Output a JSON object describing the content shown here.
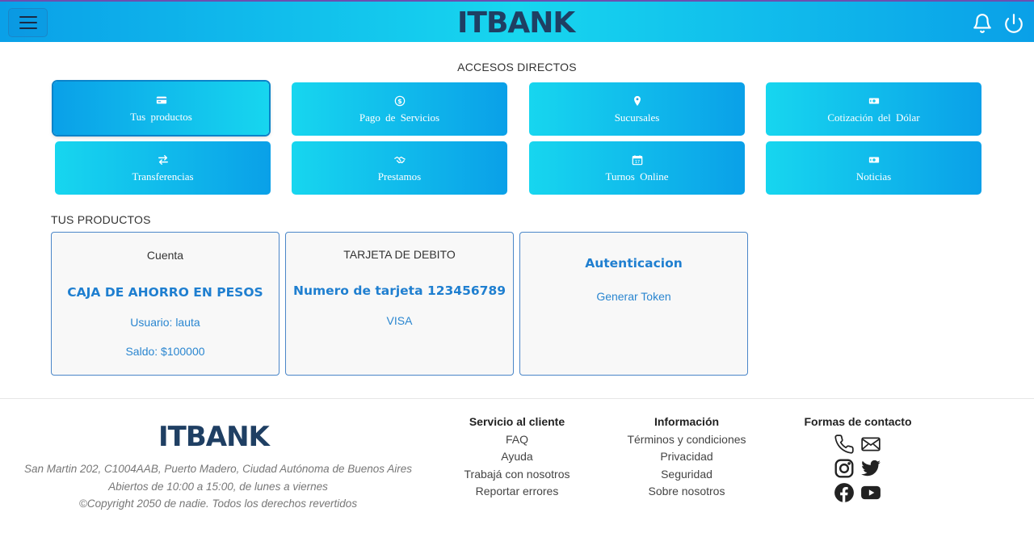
{
  "header": {
    "brand": "ITBANK",
    "menu_icon": "hamburger-menu-icon",
    "notification_icon": "bell-icon",
    "logout_icon": "power-icon"
  },
  "accesos": {
    "title": "ACCESOS DIRECTOS",
    "items": [
      {
        "label": "Tus productos",
        "icon": "credit-card-icon"
      },
      {
        "label": "Pago de Servicios",
        "icon": "dollar-circle-icon"
      },
      {
        "label": "Sucursales",
        "icon": "map-pin-icon"
      },
      {
        "label": "Cotización del Dólar",
        "icon": "cash-icon"
      },
      {
        "label": "Transferencias",
        "icon": "transfer-arrows-icon"
      },
      {
        "label": "Prestamos",
        "icon": "handshake-icon"
      },
      {
        "label": "Turnos Online",
        "icon": "calendar-icon"
      },
      {
        "label": "Noticias",
        "icon": "cash-icon"
      }
    ]
  },
  "productos": {
    "title": "TUS PRODUCTOS",
    "cuenta": {
      "heading": "Cuenta",
      "type": "CAJA DE AHORRO EN PESOS",
      "user": "Usuario: lauta",
      "balance": "Saldo: $100000"
    },
    "tarjeta": {
      "heading": "TARJETA DE DEBITO",
      "number": "Numero de tarjeta 123456789",
      "brand": "VISA"
    },
    "auth": {
      "heading": "Autenticacion",
      "action": "Generar Token"
    }
  },
  "footer": {
    "brand": "ITBANK",
    "address": "San Martin 202, C1004AAB, Puerto Madero, Ciudad Autónoma de Buenos Aires",
    "hours": "Abiertos de 10:00 a 15:00, de lunes a viernes",
    "copyright": "©Copyright 2050 de nadie. Todos los derechos revertidos",
    "servicio": {
      "title": "Servicio al cliente",
      "links": [
        "FAQ",
        "Ayuda",
        "Trabajá con nosotros",
        "Reportar errores"
      ]
    },
    "informacion": {
      "title": "Información",
      "links": [
        "Términos y condiciones",
        "Privacidad",
        "Seguridad",
        "Sobre nosotros"
      ]
    },
    "contacto": {
      "title": "Formas de contacto",
      "icons": [
        "phone-icon",
        "mail-icon",
        "instagram-icon",
        "twitter-icon",
        "facebook-icon",
        "youtube-icon"
      ]
    }
  }
}
